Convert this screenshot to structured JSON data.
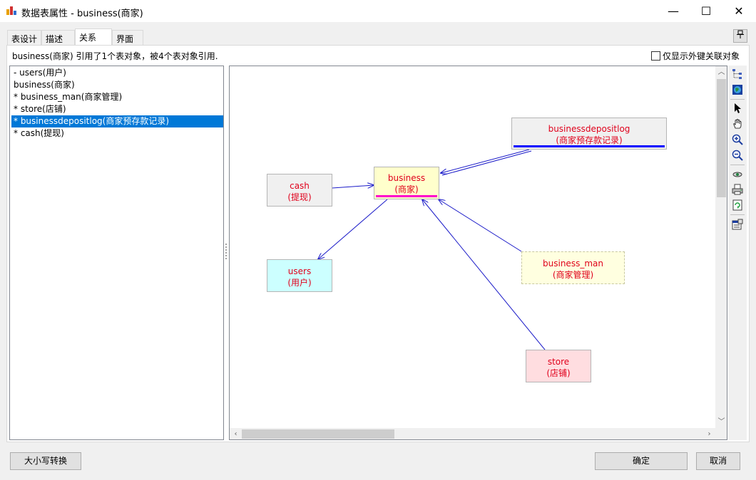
{
  "window": {
    "title": "数据表属性 - business(商家)",
    "minimize_glyph": "—",
    "maximize_glyph": "☐",
    "close_glyph": "✕"
  },
  "tabs": [
    {
      "label": "表设计",
      "active": false
    },
    {
      "label": "描述",
      "active": false
    },
    {
      "label": "关系",
      "active": true
    },
    {
      "label": "界面",
      "active": false
    }
  ],
  "pin_icon": "pin-icon",
  "summary_text": "business(商家) 引用了1个表对象，被4个表对象引用.",
  "only_fk_label": "仅显示外键关联对象",
  "tree_items": [
    {
      "label": " - users(用户)",
      "selected": false
    },
    {
      "label": "business(商家)",
      "selected": false
    },
    {
      "label": " * business_man(商家管理)",
      "selected": false
    },
    {
      "label": " * store(店铺)",
      "selected": false
    },
    {
      "label": " * businessdepositlog(商家预存款记录)",
      "selected": true
    },
    {
      "label": " * cash(提现)",
      "selected": false
    }
  ],
  "diagram": {
    "entities": [
      {
        "id": "business",
        "name": "business",
        "caption": "(商家)",
        "fill": "#ffffcc",
        "bar": "#ff00cc"
      },
      {
        "id": "businessdepositlog",
        "name": "businessdepositlog",
        "caption": "(商家预存款记录)",
        "fill": "#f0f0f0",
        "bar": "#0000ff"
      },
      {
        "id": "cash",
        "name": "cash",
        "caption": "(提现)",
        "fill": "#f0f0f0",
        "bar": ""
      },
      {
        "id": "users",
        "name": "users",
        "caption": "(用户)",
        "fill": "#ccffff",
        "bar": ""
      },
      {
        "id": "business_man",
        "name": "business_man",
        "caption": "(商家管理)",
        "fill": "#ffffe0",
        "bar": ""
      },
      {
        "id": "store",
        "name": "store",
        "caption": "(店铺)",
        "fill": "#ffdde0",
        "bar": ""
      }
    ],
    "relations": [
      {
        "from": "businessdepositlog",
        "to": "business"
      },
      {
        "from": "cash",
        "to": "business"
      },
      {
        "from": "business",
        "to": "users"
      },
      {
        "from": "business_man",
        "to": "business"
      },
      {
        "from": "store",
        "to": "business"
      }
    ],
    "line_color": "#1a1ac8"
  },
  "toolbar_icons": [
    "tree-layout-icon",
    "globe-icon",
    "pointer-icon",
    "hand-icon",
    "zoom-in-icon",
    "zoom-out-icon",
    "eye-icon",
    "printer-icon",
    "refresh-icon",
    "properties-icon"
  ],
  "buttons": {
    "case_convert": "大小写转换",
    "ok": "确定",
    "cancel": "取消"
  }
}
